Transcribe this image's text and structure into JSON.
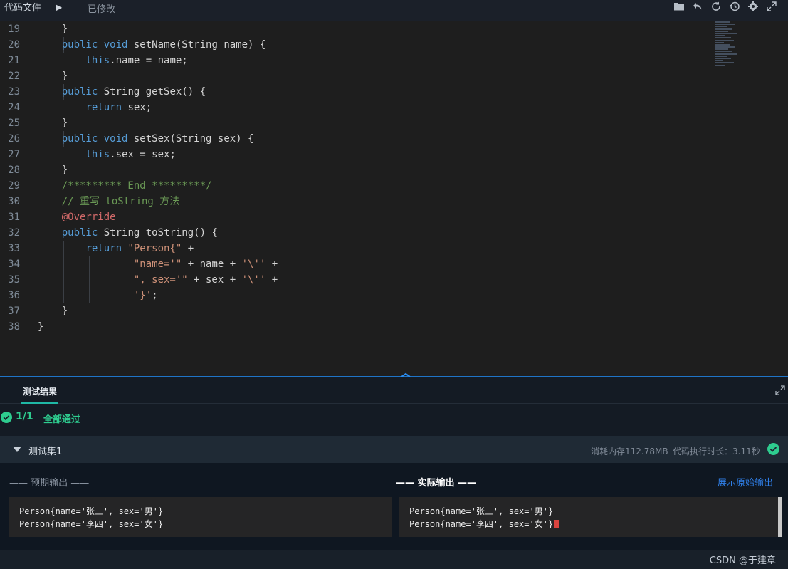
{
  "topbar": {
    "tab_label": "代码文件",
    "modified_label": "已修改",
    "tools": [
      "folder-icon",
      "undo-icon",
      "refresh-icon",
      "history-icon",
      "settings-icon",
      "fullscreen-icon"
    ]
  },
  "editor": {
    "lines": [
      {
        "n": "19",
        "text": "    }"
      },
      {
        "n": "20",
        "text": "    public void setName(String name) {"
      },
      {
        "n": "21",
        "text": "        this.name = name;"
      },
      {
        "n": "22",
        "text": "    }"
      },
      {
        "n": "23",
        "text": "    public String getSex() {"
      },
      {
        "n": "24",
        "text": "        return sex;"
      },
      {
        "n": "25",
        "text": "    }"
      },
      {
        "n": "26",
        "text": "    public void setSex(String sex) {"
      },
      {
        "n": "27",
        "text": "        this.sex = sex;"
      },
      {
        "n": "28",
        "text": "    }"
      },
      {
        "n": "29",
        "text": "    /********* End *********/"
      },
      {
        "n": "30",
        "text": "    // 重写 toString 方法"
      },
      {
        "n": "31",
        "text": "    @Override"
      },
      {
        "n": "32",
        "text": "    public String toString() {"
      },
      {
        "n": "33",
        "text": "        return \"Person{\" +"
      },
      {
        "n": "34",
        "text": "                \"name='\" + name + '\\'' +"
      },
      {
        "n": "35",
        "text": "                \", sex='\" + sex + '\\'' +"
      },
      {
        "n": "36",
        "text": "                '}';"
      },
      {
        "n": "37",
        "text": "    }"
      },
      {
        "n": "38",
        "text": "}"
      }
    ]
  },
  "results": {
    "tab_label": "测试结果",
    "pass_count": "1/1",
    "pass_text": "全部通过",
    "set_title": "测试集1",
    "memory": "消耗内存112.78MB",
    "exec_time": "代码执行时长：3.11秒",
    "expected_label": "—— 预期输出 ——",
    "actual_label": "—— 实际输出 ——",
    "raw_output_link": "展示原始输出",
    "expected_lines": [
      "Person{name='张三', sex='男'}",
      "Person{name='李四', sex='女'}"
    ],
    "actual_lines": [
      "Person{name='张三', sex='男'}",
      "Person{name='李四', sex='女'}"
    ]
  },
  "footer": {
    "watermark": "CSDN @于建章"
  },
  "colors": {
    "accent": "#1fb8a5",
    "pass_green": "#2ecc8f",
    "link_blue": "#2f7ee6",
    "splitter_blue": "#1f74c7"
  }
}
